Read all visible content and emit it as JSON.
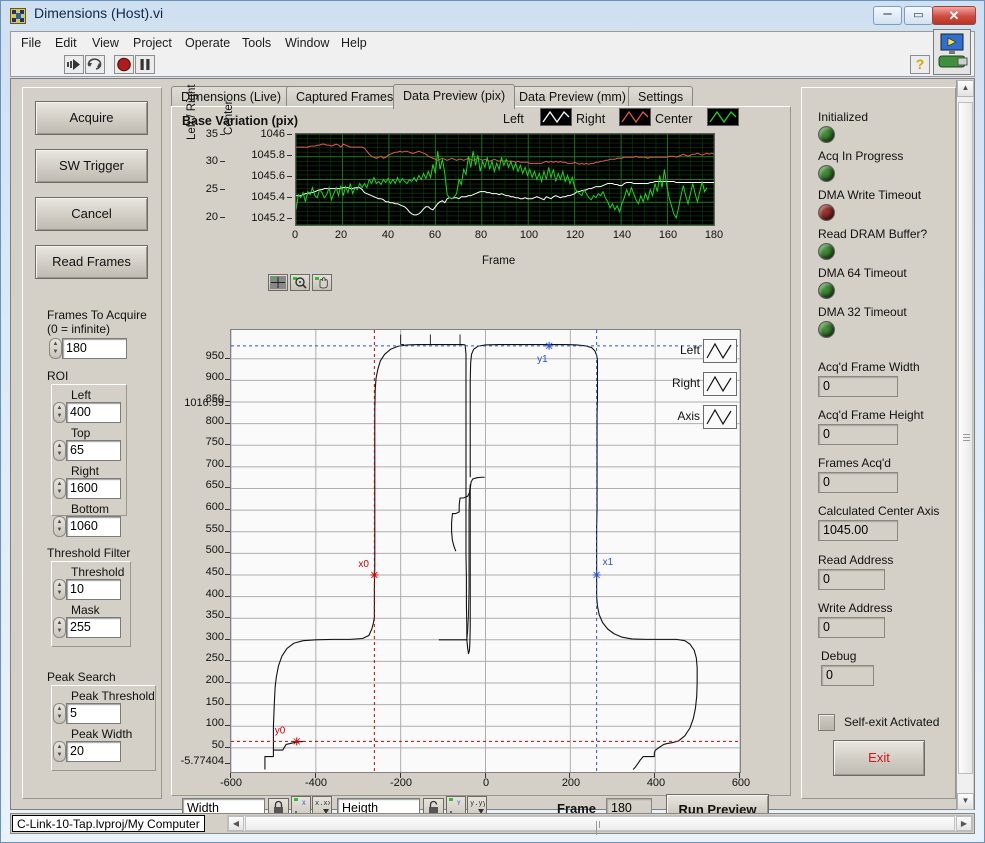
{
  "window": {
    "title": "Dimensions (Host).vi",
    "icon": "labview-vi-icon",
    "minimize": "–",
    "maximize": "▭",
    "close": "✕"
  },
  "menubar": {
    "items": [
      "File",
      "Edit",
      "View",
      "Project",
      "Operate",
      "Tools",
      "Window",
      "Help"
    ]
  },
  "toolbar": {
    "run_icon": "run-arrow-icon",
    "run_continuous_icon": "run-continuously-icon",
    "abort_icon": "abort-stop-icon",
    "pause_icon": "pause-icon",
    "help_icon": "?",
    "vi_icon": "vi-connector-icon"
  },
  "left_panel": {
    "buttons": [
      {
        "label": "Acquire"
      },
      {
        "label": "SW Trigger"
      },
      {
        "label": "Cancel"
      },
      {
        "label": "Read Frames"
      }
    ],
    "frames_to_acquire": {
      "label_line1": "Frames To Acquire",
      "label_line2": "(0 = infinite)",
      "value": "180"
    },
    "roi": {
      "title": "ROI",
      "fields": [
        {
          "label": "Left",
          "value": "400"
        },
        {
          "label": "Top",
          "value": "65"
        },
        {
          "label": "Right",
          "value": "1600"
        },
        {
          "label": "Bottom",
          "value": "1060"
        }
      ]
    },
    "threshold_filter": {
      "title": "Threshold Filter",
      "fields": [
        {
          "label": "Threshold",
          "value": "10"
        },
        {
          "label": "Mask",
          "value": "255"
        }
      ]
    },
    "peak_search": {
      "title": "Peak Search",
      "fields": [
        {
          "label": "Peak Threshold",
          "value": "5"
        },
        {
          "label": "Peak Width",
          "value": "20"
        }
      ]
    }
  },
  "tabs": {
    "items": [
      "Dimensions (Live)",
      "Captured Frames",
      "Data Preview (pix)",
      "Data Preview (mm)",
      "Settings"
    ],
    "active_index": 2
  },
  "graph_tools": {
    "cursor_icon": "cursor-crosshair-icon",
    "zoom_icon": "zoom-magnifier-icon",
    "pan_icon": "pan-hand-icon"
  },
  "bottom_bar": {
    "width_field": {
      "value": "Width"
    },
    "height_field": {
      "value": "Heigth"
    },
    "lock_x_icon": "lock-closed-icon",
    "lock_y_icon": "lock-open-icon",
    "scale_x_icon": "x-scale-icon",
    "format_x_icon": "x-format-icon",
    "scale_y_icon": "y-scale-icon",
    "format_y_icon": "y-format-icon",
    "frame_label": "Frame",
    "frame_value": "180",
    "run_preview_label": "Run Preview"
  },
  "right_panel": {
    "leds": [
      {
        "label": "Initialized",
        "state": "green",
        "color": "#3d7d34"
      },
      {
        "label": "Acq In Progress",
        "state": "green",
        "color": "#3d7d34"
      },
      {
        "label": "DMA Write Timeout",
        "state": "red",
        "color": "#8c2b28"
      },
      {
        "label": "Read DRAM Buffer?",
        "state": "green",
        "color": "#3d7d34"
      },
      {
        "label": "DMA 64 Timeout",
        "state": "green",
        "color": "#3d7d34"
      },
      {
        "label": "DMA 32 Timeout",
        "state": "green",
        "color": "#3d7d34"
      }
    ],
    "indicators": [
      {
        "label": "Acq'd Frame Width",
        "value": "0"
      },
      {
        "label": "Acq'd Frame Height",
        "value": "0"
      },
      {
        "label": "Frames Acq'd",
        "value": "0"
      },
      {
        "label": "Calculated Center Axis",
        "value": "1045.00"
      },
      {
        "label": "Read Address",
        "value": "0"
      },
      {
        "label": "Write Address",
        "value": "0"
      },
      {
        "label": "Debug",
        "value": "0"
      }
    ],
    "self_exit": {
      "label": "Self-exit Activated",
      "checked": false
    },
    "exit_button": {
      "label": "Exit",
      "color": "#d01616"
    }
  },
  "statusbar": {
    "project_path": "C-Link-10-Tap.lvproj/My Computer"
  },
  "chart_data": [
    {
      "id": "base-variation",
      "type": "line",
      "title": "Base Variation (pix)",
      "xlabel": "Frame",
      "ylabel_left": "Left / Right",
      "ylabel_right": "Center",
      "background": "#000000",
      "grid": true,
      "grid_color": "#1c6b1c",
      "legend_position": "top-right",
      "xlim": [
        0,
        180
      ],
      "xticks": [
        0,
        20,
        40,
        60,
        80,
        100,
        120,
        140,
        160,
        180
      ],
      "y_left_lim": [
        18,
        36
      ],
      "y_left_ticks": [
        20,
        25,
        30,
        35
      ],
      "y_right_lim": [
        1045.15,
        1046.05
      ],
      "y_right_ticks": [
        1045.2,
        1045.4,
        1045.6,
        1045.8,
        1046
      ],
      "series": [
        {
          "name": "Left",
          "color": "#ffffff",
          "axis": "right",
          "values": [
            1045.44,
            1045.44,
            1045.44,
            1045.45,
            1045.46,
            1045.46,
            1045.47,
            1045.47,
            1045.48,
            1045.49,
            1045.5,
            1045.5,
            1045.51,
            1045.51,
            1045.51,
            1045.51,
            1045.51,
            1045.51,
            1045.51,
            1045.51,
            1045.52,
            1045.52,
            1045.52,
            1045.51,
            1045.51,
            1045.52,
            1045.52,
            1045.52,
            1045.5,
            1045.47,
            1045.46,
            1045.45,
            1045.44,
            1045.43,
            1045.42,
            1045.41,
            1045.41,
            1045.4,
            1045.38,
            1045.38,
            1045.37,
            1045.37,
            1045.36,
            1045.36,
            1045.35,
            1045.34,
            1045.33,
            1045.31,
            1045.28,
            1045.26,
            1045.25,
            1045.25,
            1045.26,
            1045.28,
            1045.31,
            1045.33,
            1045.33,
            1045.31,
            1045.3,
            1045.33,
            1045.36,
            1045.38,
            1045.39,
            1045.37,
            1045.41,
            1045.42,
            1045.41,
            1045.42,
            1045.42,
            1045.41,
            1045.43,
            1045.43,
            1045.43,
            1045.44,
            1045.44,
            1045.45,
            1045.46,
            1045.47,
            1045.48,
            1045.48,
            1045.48,
            1045.47,
            1045.47,
            1045.46,
            1045.46,
            1045.46,
            1045.45,
            1045.46,
            1045.45,
            1045.44,
            1045.44,
            1045.43,
            1045.43,
            1045.42,
            1045.42,
            1045.41,
            1045.41,
            1045.42,
            1045.41,
            1045.41,
            1045.41,
            1045.42,
            1045.43,
            1045.42,
            1045.41,
            1045.4,
            1045.43,
            1045.42,
            1045.41,
            1045.43,
            1045.44,
            1045.43,
            1045.42,
            1045.43,
            1045.43,
            1045.44,
            1045.44,
            1045.45,
            1045.46,
            1045.48,
            1045.48,
            1045.49,
            1045.49,
            1045.5,
            1045.51,
            1045.51,
            1045.52,
            1045.53,
            1045.53,
            1045.53,
            1045.54,
            1045.55,
            1045.56,
            1045.56,
            1045.56,
            1045.55,
            1045.55,
            1045.54,
            1045.54,
            1045.56,
            1045.57,
            1045.57,
            1045.57,
            1045.56,
            1045.56,
            1045.56,
            1045.56,
            1045.56,
            1045.56,
            1045.56,
            1045.57,
            1045.57,
            1045.58,
            1045.58,
            1045.58,
            1045.58,
            1045.58,
            1045.58,
            1045.58,
            1045.58,
            1045.58,
            1045.57,
            1045.57,
            1045.57,
            1045.57,
            1045.57,
            1045.57,
            1045.57,
            1045.57,
            1045.57,
            1045.57,
            1045.57,
            1045.57,
            1045.57,
            1045.57,
            1045.57,
            1045.57,
            1045.57
          ]
        },
        {
          "name": "Right",
          "color": "#e05a4e",
          "axis": "right",
          "values": [
            1045.92,
            1045.92,
            1045.92,
            1045.92,
            1045.92,
            1045.92,
            1045.93,
            1045.93,
            1045.93,
            1045.94,
            1045.94,
            1045.95,
            1045.95,
            1045.94,
            1045.94,
            1045.93,
            1045.94,
            1045.95,
            1045.94,
            1045.92,
            1045.95,
            1045.94,
            1045.93,
            1045.92,
            1045.92,
            1045.92,
            1045.92,
            1045.92,
            1045.92,
            1045.91,
            1045.88,
            1045.85,
            1045.83,
            1045.82,
            1045.81,
            1045.82,
            1045.83,
            1045.81,
            1045.82,
            1045.84,
            1045.85,
            1045.86,
            1045.87,
            1045.87,
            1045.88,
            1045.87,
            1045.88,
            1045.88,
            1045.87,
            1045.86,
            1045.86,
            1045.87,
            1045.88,
            1045.87,
            1045.86,
            1045.85,
            1045.83,
            1045.82,
            1045.81,
            1045.8,
            1045.79,
            1045.8,
            1045.81,
            1045.8,
            1045.79,
            1045.8,
            1045.81,
            1045.8,
            1045.79,
            1045.8,
            1045.8,
            1045.79,
            1045.8,
            1045.81,
            1045.8,
            1045.79,
            1045.8,
            1045.81,
            1045.8,
            1045.79,
            1045.8,
            1045.79,
            1045.78,
            1045.79,
            1045.8,
            1045.79,
            1045.78,
            1045.79,
            1045.78,
            1045.79,
            1045.78,
            1045.78,
            1045.78,
            1045.77,
            1045.78,
            1045.77,
            1045.77,
            1045.77,
            1045.77,
            1045.76,
            1045.76,
            1045.76,
            1045.76,
            1045.76,
            1045.76,
            1045.77,
            1045.78,
            1045.77,
            1045.78,
            1045.77,
            1045.78,
            1045.77,
            1045.78,
            1045.77,
            1045.77,
            1045.76,
            1045.76,
            1045.76,
            1045.77,
            1045.76,
            1045.75,
            1045.76,
            1045.75,
            1045.76,
            1045.75,
            1045.76,
            1045.76,
            1045.77,
            1045.77,
            1045.78,
            1045.78,
            1045.79,
            1045.79,
            1045.8,
            1045.8,
            1045.8,
            1045.81,
            1045.81,
            1045.81,
            1045.82,
            1045.82,
            1045.82,
            1045.82,
            1045.82,
            1045.83,
            1045.82,
            1045.82,
            1045.82,
            1045.82,
            1045.81,
            1045.82,
            1045.82,
            1045.82,
            1045.82,
            1045.82,
            1045.82,
            1045.82,
            1045.82,
            1045.83,
            1045.83,
            1045.83,
            1045.82,
            1045.83,
            1045.84,
            1045.85,
            1045.84,
            1045.83,
            1045.84,
            1045.85,
            1045.85,
            1045.86,
            1045.85,
            1045.84,
            1045.85,
            1045.86,
            1045.85,
            1045.86,
            1045.85
          ]
        },
        {
          "name": "Center",
          "color": "#1fd41f",
          "axis": "right",
          "values": [
            1045.3,
            1045.45,
            1045.42,
            1045.47,
            1045.38,
            1045.48,
            1045.45,
            1045.52,
            1045.44,
            1045.42,
            1045.5,
            1045.47,
            1045.42,
            1045.45,
            1045.52,
            1045.4,
            1045.46,
            1045.52,
            1045.44,
            1045.54,
            1045.44,
            1045.53,
            1045.47,
            1045.56,
            1045.46,
            1045.52,
            1045.5,
            1045.56,
            1045.52,
            1045.56,
            1045.52,
            1045.6,
            1045.56,
            1045.62,
            1045.56,
            1045.58,
            1045.55,
            1045.6,
            1045.57,
            1045.61,
            1045.56,
            1045.6,
            1045.56,
            1045.62,
            1045.57,
            1045.61,
            1045.58,
            1045.56,
            1045.6,
            1045.58,
            1045.62,
            1045.58,
            1045.64,
            1045.6,
            1045.66,
            1045.61,
            1045.68,
            1045.62,
            1045.75,
            1045.66,
            1045.88,
            1045.7,
            1045.8,
            1045.66,
            1045.45,
            1045.42,
            1045.41,
            1045.43,
            1045.46,
            1045.6,
            1045.55,
            1045.7,
            1045.65,
            1045.83,
            1045.72,
            1045.88,
            1045.74,
            1045.84,
            1045.68,
            1045.78,
            1045.72,
            1045.82,
            1045.7,
            1045.78,
            1045.68,
            1045.76,
            1045.7,
            1045.82,
            1045.74,
            1045.8,
            1045.72,
            1045.78,
            1045.7,
            1045.76,
            1045.68,
            1045.74,
            1045.66,
            1045.72,
            1045.64,
            1045.7,
            1045.62,
            1045.68,
            1045.6,
            1045.66,
            1045.58,
            1045.68,
            1045.6,
            1045.72,
            1045.62,
            1045.7,
            1045.58,
            1045.66,
            1045.6,
            1045.68,
            1045.58,
            1045.64,
            1045.56,
            1045.62,
            1045.52,
            1045.48,
            1045.46,
            1045.44,
            1045.5,
            1045.46,
            1045.42,
            1045.4,
            1045.44,
            1045.42,
            1045.46,
            1045.44,
            1045.48,
            1045.42,
            1045.38,
            1045.32,
            1045.36,
            1045.3,
            1045.34,
            1045.28,
            1045.36,
            1045.42,
            1045.5,
            1045.44,
            1045.52,
            1045.46,
            1045.4,
            1045.36,
            1045.44,
            1045.38,
            1045.46,
            1045.4,
            1045.5,
            1045.44,
            1045.56,
            1045.48,
            1045.64,
            1045.52,
            1045.7,
            1045.54,
            1045.42,
            1045.34,
            1045.26,
            1045.22,
            1045.32,
            1045.44,
            1045.54,
            1045.44,
            1045.36,
            1045.46,
            1045.56,
            1045.46,
            1045.38,
            1045.48,
            1045.58,
            1045.48,
            1045.52
          ]
        }
      ]
    },
    {
      "id": "profile-preview",
      "type": "line",
      "title": "",
      "xlabel": "",
      "ylabel": "",
      "background": "#fafafa",
      "grid": true,
      "grid_color": "#9a9a9a",
      "legend_position": "top-right",
      "legend_entries": [
        "Left",
        "Right",
        "Axis"
      ],
      "xlim": [
        -600,
        600
      ],
      "xticks": [
        -600,
        -400,
        -200,
        0,
        200,
        400,
        600
      ],
      "ylim": [
        -5.77404,
        1016.59
      ],
      "ytick_min_label": "-5.77404",
      "ytick_max_label": "1016.59",
      "yticks": [
        50,
        100,
        150,
        200,
        250,
        300,
        350,
        400,
        450,
        500,
        550,
        600,
        650,
        700,
        750,
        800,
        850,
        900,
        950
      ],
      "cursors": [
        {
          "name": "x0",
          "color": "#cc0000",
          "x": -262,
          "y": 450,
          "style": "dashed-vertical"
        },
        {
          "name": "y0",
          "color": "#cc0000",
          "x": -445,
          "y": 65,
          "style": "dashed-horizontal"
        },
        {
          "name": "x1",
          "color": "#2a4fd4",
          "x": 262,
          "y": 450,
          "style": "dashed-vertical"
        },
        {
          "name": "y1",
          "color": "#2a4fd4",
          "x": 150,
          "y": 980,
          "style": "dashed-horizontal"
        }
      ],
      "trace_color": "#111111"
    }
  ]
}
